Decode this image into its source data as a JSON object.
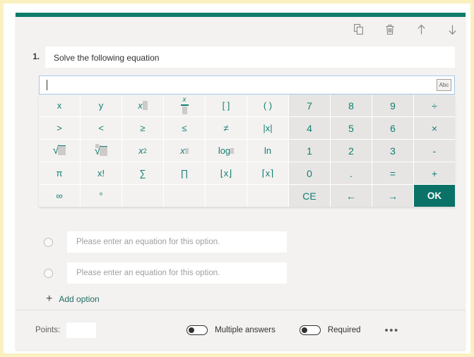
{
  "theme": {
    "accent": "#0e7c6b",
    "key_text": "#127e71",
    "ok_button_bg": "#0b7268",
    "outer_border": "#fbf0c0",
    "card_bg": "#f3f2f1"
  },
  "toolbar": {
    "copy_label": "Copy question",
    "delete_label": "Delete question",
    "move_up_label": "Move question up",
    "move_down_label": "Move question down",
    "icons": [
      "copy-icon",
      "trash-icon",
      "arrow-up-icon",
      "arrow-down-icon"
    ]
  },
  "question": {
    "number": "1.",
    "title": "Solve the following equation"
  },
  "equation_input": {
    "value": "",
    "placeholder": "",
    "mode_toggle_label": "Abc"
  },
  "keypad": {
    "rows": [
      [
        {
          "label": "x",
          "name": "key-x",
          "type": "math"
        },
        {
          "label": "y",
          "name": "key-y",
          "type": "math"
        },
        {
          "label": "x□",
          "name": "key-subscript",
          "type": "subscript"
        },
        {
          "label": "x/□",
          "name": "key-fraction",
          "type": "fraction"
        },
        {
          "label": "[ ]",
          "name": "key-square-brackets",
          "type": "math"
        },
        {
          "label": "( )",
          "name": "key-parentheses",
          "type": "math"
        },
        {
          "label": "7",
          "name": "key-7",
          "type": "num"
        },
        {
          "label": "8",
          "name": "key-8",
          "type": "num"
        },
        {
          "label": "9",
          "name": "key-9",
          "type": "num"
        },
        {
          "label": "÷",
          "name": "key-divide",
          "type": "num"
        }
      ],
      [
        {
          "label": ">",
          "name": "key-greater-than",
          "type": "math"
        },
        {
          "label": "<",
          "name": "key-less-than",
          "type": "math"
        },
        {
          "label": "≥",
          "name": "key-greater-equal",
          "type": "math"
        },
        {
          "label": "≤",
          "name": "key-less-equal",
          "type": "math"
        },
        {
          "label": "≠",
          "name": "key-not-equal",
          "type": "math"
        },
        {
          "label": "|x|",
          "name": "key-absolute-value",
          "type": "math"
        },
        {
          "label": "4",
          "name": "key-4",
          "type": "num"
        },
        {
          "label": "5",
          "name": "key-5",
          "type": "num"
        },
        {
          "label": "6",
          "name": "key-6",
          "type": "num"
        },
        {
          "label": "×",
          "name": "key-multiply",
          "type": "num"
        }
      ],
      [
        {
          "label": "√□",
          "name": "key-square-root",
          "type": "sqrt"
        },
        {
          "label": "ⁿ√□",
          "name": "key-nth-root",
          "type": "nroot"
        },
        {
          "label": "x²",
          "name": "key-x-squared",
          "type": "squared"
        },
        {
          "label": "x^□",
          "name": "key-power",
          "type": "power"
        },
        {
          "label": "log□",
          "name": "key-log",
          "type": "log"
        },
        {
          "label": "ln",
          "name": "key-ln",
          "type": "math"
        },
        {
          "label": "1",
          "name": "key-1",
          "type": "num"
        },
        {
          "label": "2",
          "name": "key-2",
          "type": "num"
        },
        {
          "label": "3",
          "name": "key-3",
          "type": "num"
        },
        {
          "label": "-",
          "name": "key-minus",
          "type": "num"
        }
      ],
      [
        {
          "label": "π",
          "name": "key-pi",
          "type": "math"
        },
        {
          "label": "x!",
          "name": "key-factorial",
          "type": "math"
        },
        {
          "label": "∑",
          "name": "key-summation",
          "type": "math"
        },
        {
          "label": "∏",
          "name": "key-product",
          "type": "math"
        },
        {
          "label": "⌊x⌋",
          "name": "key-floor",
          "type": "math"
        },
        {
          "label": "⌈x⌉",
          "name": "key-ceiling",
          "type": "math"
        },
        {
          "label": "0",
          "name": "key-0",
          "type": "num"
        },
        {
          "label": ".",
          "name": "key-decimal-point",
          "type": "num"
        },
        {
          "label": "=",
          "name": "key-equals",
          "type": "num"
        },
        {
          "label": "+",
          "name": "key-plus",
          "type": "num"
        }
      ],
      [
        {
          "label": "∞",
          "name": "key-infinity",
          "type": "math"
        },
        {
          "label": "°",
          "name": "key-degree",
          "type": "math"
        },
        {
          "label": "",
          "name": "key-blank-1",
          "type": "blank"
        },
        {
          "label": "",
          "name": "key-blank-2",
          "type": "blank"
        },
        {
          "label": "",
          "name": "key-blank-3",
          "type": "blank"
        },
        {
          "label": "",
          "name": "key-blank-4",
          "type": "blank"
        },
        {
          "label": "CE",
          "name": "key-clear-entry",
          "type": "num"
        },
        {
          "label": "←",
          "name": "key-arrow-left",
          "type": "num"
        },
        {
          "label": "→",
          "name": "key-arrow-right",
          "type": "num"
        },
        {
          "label": "OK",
          "name": "key-ok",
          "type": "ok"
        }
      ]
    ]
  },
  "options": {
    "items": [
      {
        "placeholder": "Please enter an equation for this option.",
        "value": "",
        "selected": false
      },
      {
        "placeholder": "Please enter an equation for this option.",
        "value": "",
        "selected": false
      }
    ],
    "add_option_label": "Add option",
    "add_option_icon": "plus-icon"
  },
  "footer": {
    "points_label": "Points:",
    "points_value": "",
    "multiple_answers_label": "Multiple answers",
    "multiple_answers_on": false,
    "required_label": "Required",
    "required_on": false,
    "more_label": "•••"
  }
}
